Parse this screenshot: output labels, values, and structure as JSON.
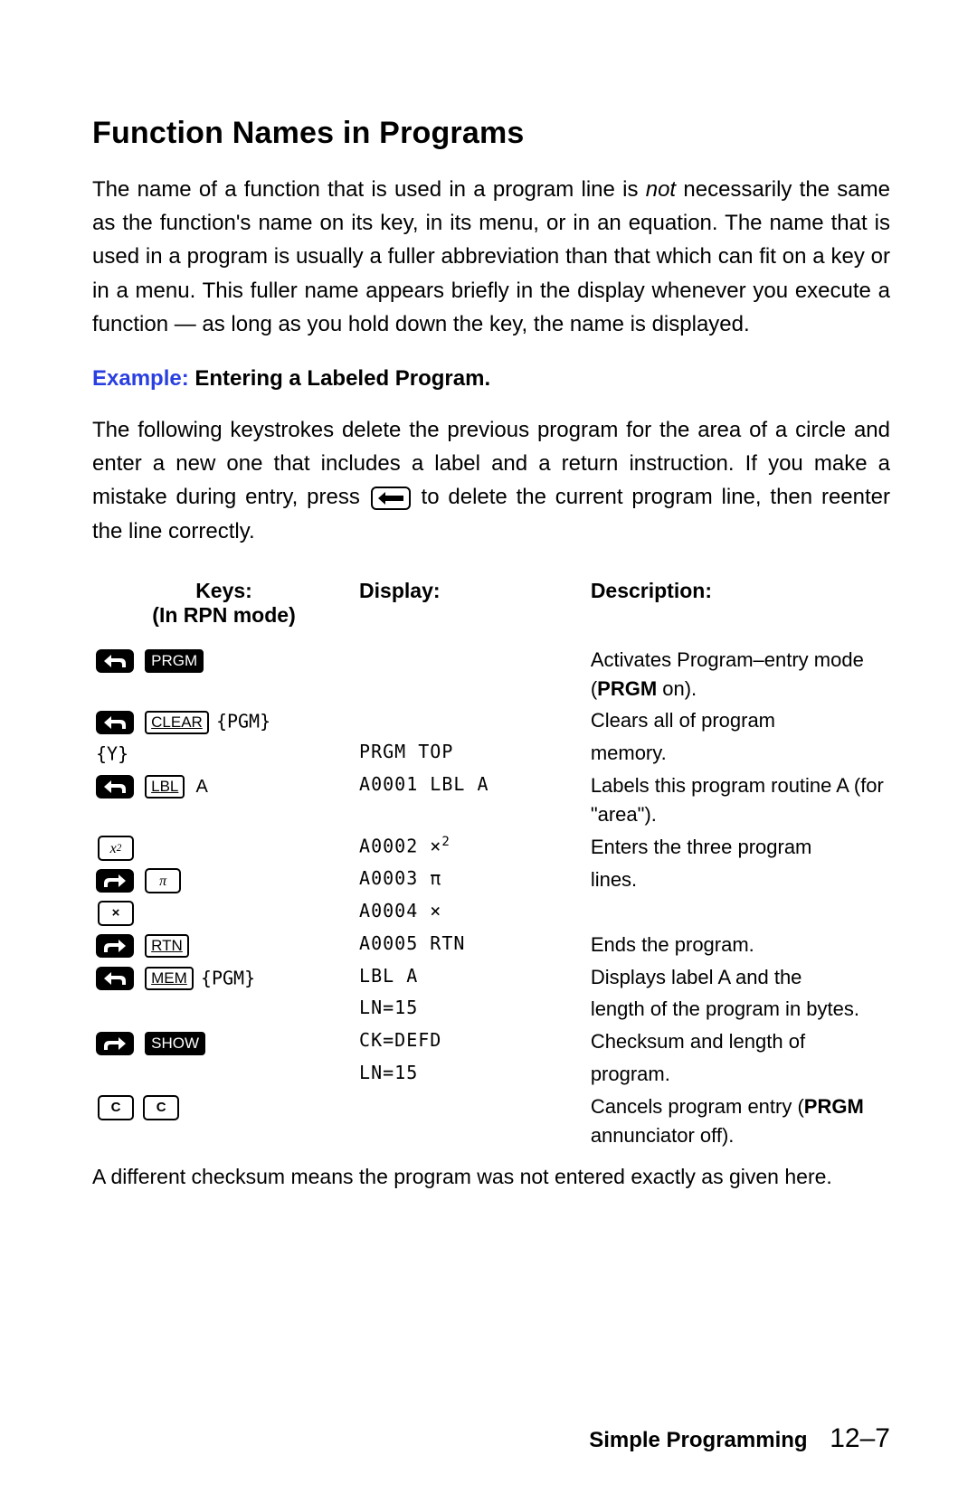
{
  "section_title": "Function Names in Programs",
  "para1_a": "The name of a function that is used in a program line is ",
  "para1_not": "not",
  "para1_b": " necessarily the same as the function's name on its key, in its menu, or in an equation. The name that is used in a program is usually a fuller abbreviation than that which can fit on a key or in a menu. This fuller name appears briefly in the display whenever you execute a function — as long as you hold down the key, the name is displayed.",
  "example_label": "Example:",
  "example_title": " Entering a Labeled Program.",
  "para2_a": "The following keystrokes delete the previous program for the area of a circle and enter a new one that includes a label and a return instruction. If you make a mistake during entry, press ",
  "para2_b": " to delete the current program line, then reenter the line correctly.",
  "header_keys_l1": "Keys:",
  "header_keys_l2": "(In RPN mode)",
  "header_display": "Display:",
  "header_desc": "Description:",
  "keys": {
    "PRGM": "PRGM",
    "CLEAR": "CLEAR",
    "LBL": "LBL",
    "RTN": "RTN",
    "MEM": "MEM",
    "SHOW": "SHOW",
    "C": "C",
    "A": "A",
    "PGM_menu": "{PGM}",
    "Y_menu": "{Y}",
    "x2": "x",
    "x2_sup": "2",
    "pi": "π",
    "times": "×"
  },
  "rows": [
    {
      "display": "",
      "desc_a": "Activates Program–entry mode (",
      "desc_bold": "PRGM",
      "desc_b": " on)."
    },
    {
      "display": "",
      "desc": "Clears all of program"
    },
    {
      "display": "PRGM TOP",
      "desc": "memory."
    },
    {
      "display": "A0001 LBL A",
      "desc": "Labels this program routine A (for \"area\")."
    },
    {
      "display": "A0002 ×",
      "sup": "2",
      "desc": "Enters the three program"
    },
    {
      "display": "A0003 π",
      "desc": "lines."
    },
    {
      "display": "A0004 ×",
      "desc": ""
    },
    {
      "display": "A0005 RTN",
      "desc": "Ends the program."
    },
    {
      "display": "LBL A",
      "desc": "Displays label A and the"
    },
    {
      "display": "LN=15",
      "desc": "length of the program in bytes."
    },
    {
      "display": "CK=DEFD",
      "desc": "Checksum and length of"
    },
    {
      "display": "LN=15",
      "desc": "program."
    },
    {
      "display": "",
      "desc_a": "Cancels program entry (",
      "desc_bold": "PRGM",
      "desc_b": " annunciator off)."
    }
  ],
  "footnote": "A different checksum means the program was not entered exactly as given here.",
  "footer_title": "Simple Programming",
  "footer_page": "12–7"
}
